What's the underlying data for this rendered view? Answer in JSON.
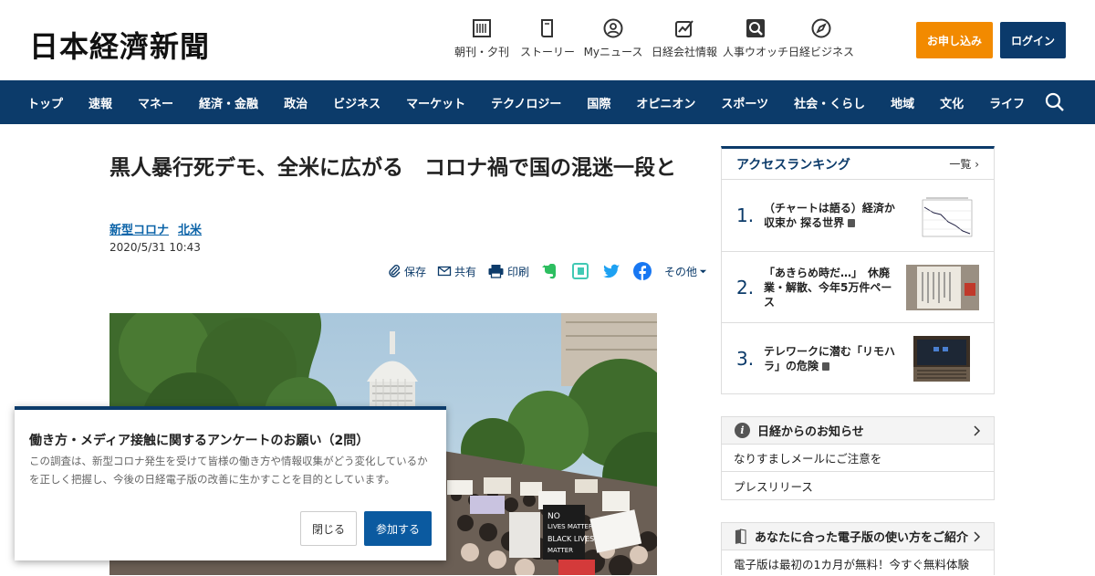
{
  "header": {
    "logo": "日本経濟新聞",
    "icons": [
      {
        "label": "朝刊・夕刊",
        "icon": "newspaper-icon"
      },
      {
        "label": "ストーリー",
        "icon": "book-icon"
      },
      {
        "label": "Myニュース",
        "icon": "user-icon"
      },
      {
        "label": "日経会社情報",
        "icon": "chart-icon"
      },
      {
        "label": "人事ウオッチ",
        "icon": "search-person-icon"
      },
      {
        "label": "日経ビジネス",
        "icon": "compass-icon"
      }
    ],
    "apply_label": "お申し込み",
    "login_label": "ログイン"
  },
  "nav": {
    "items": [
      "トップ",
      "速報",
      "マネー",
      "経済・金融",
      "政治",
      "ビジネス",
      "マーケット",
      "テクノロジー",
      "国際",
      "オピニオン",
      "スポーツ",
      "社会・くらし",
      "地域",
      "文化",
      "ライフ"
    ]
  },
  "article": {
    "title": "黒人暴行死デモ、全米に広がる　コロナ禍で国の混迷一段と",
    "tags": [
      "新型コロナ",
      "北米"
    ],
    "date": "2020/5/31 10:43",
    "tools": {
      "save": "保存",
      "share": "共有",
      "print": "印刷",
      "more": "その他"
    }
  },
  "dialog": {
    "title": "働き方・メディア接触に関するアンケートのお願い（2問）",
    "body": "この調査は、新型コロナ発生を受けて皆様の働き方や情報収集がどう変化しているかを正しく把握し、今後の日経電子版の改善に生かすことを目的としています。",
    "close_label": "閉じる",
    "join_label": "参加する"
  },
  "ranking": {
    "title": "アクセスランキング",
    "more_label": "一覧",
    "items": [
      {
        "num": "1.",
        "text": "（チャートは語る）経済か収束か 探る世界"
      },
      {
        "num": "2.",
        "text": "「あきらめ時だ…」　休廃業・解散、今年5万件ペース"
      },
      {
        "num": "3.",
        "text": "テレワークに潜む「リモハラ」の危険"
      }
    ]
  },
  "news": {
    "title": "日経からのお知らせ",
    "items": [
      "なりすましメールにご注意を",
      "プレスリリース"
    ]
  },
  "guide": {
    "title": "あなたに合った電子版の使い方をご紹介",
    "text": "電子版は最初の1カ月が無料！今すぐ無料体験"
  }
}
